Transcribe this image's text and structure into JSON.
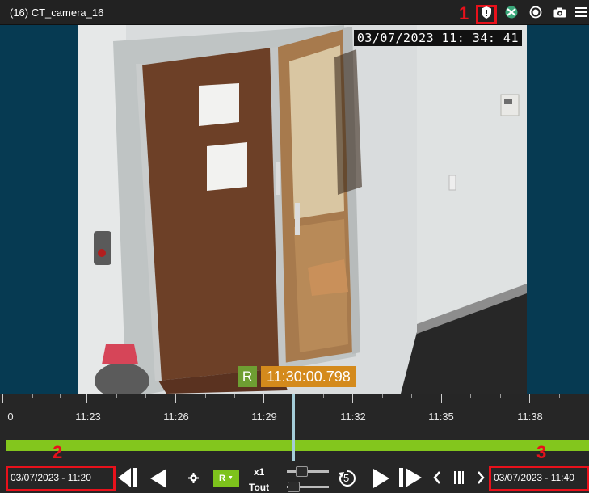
{
  "window": {
    "title": "(16) CT_camera_16"
  },
  "toolbar_icons": [
    "shield-icon",
    "privacy-mask-icon",
    "record-icon",
    "camera-icon",
    "menu-icon"
  ],
  "annotations": {
    "marker_1": "1",
    "marker_2": "2",
    "marker_3": "3",
    "color": "#e8111b"
  },
  "video": {
    "osd_timestamp": "03/07/2023  11: 34: 41",
    "recording_badge": "R",
    "recording_time": "11:30:00.798"
  },
  "timeline": {
    "tick_labels": [
      "0",
      "11:23",
      "11:26",
      "11:29",
      "11:32",
      "11:35",
      "11:38"
    ],
    "recorded_color": "#83c61d"
  },
  "controls": {
    "start_date": "03/07/2023 - 11:20",
    "end_date": "03/07/2023 - 11:40",
    "record_mode_label": "R",
    "speed_label": "x1",
    "scope_label": "Tout",
    "skip_seconds": "5"
  },
  "colors": {
    "background": "#063a52",
    "record_badge": "#6e9e32",
    "record_time": "#d48a1c"
  }
}
